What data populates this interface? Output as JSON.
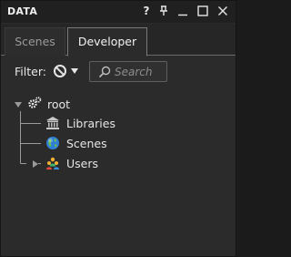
{
  "window": {
    "title": "DATA",
    "help_label": "?",
    "pin_label": "†",
    "minimize_label": "—",
    "maximize_label": "□",
    "close_label": "✕"
  },
  "tabs": [
    {
      "label": "Scenes",
      "active": false
    },
    {
      "label": "Developer",
      "active": true
    }
  ],
  "filter": {
    "label": "Filter:",
    "icon": "no-filter-icon",
    "search_placeholder": "Search",
    "search_value": ""
  },
  "tree": {
    "root": {
      "label": "root",
      "icon": "gears-icon",
      "expanded": true
    },
    "children": [
      {
        "label": "Libraries",
        "icon": "library-icon",
        "expandable": false
      },
      {
        "label": "Scenes",
        "icon": "globe-icon",
        "expandable": false
      },
      {
        "label": "Users",
        "icon": "users-icon",
        "expandable": true,
        "expanded": false
      }
    ]
  },
  "colors": {
    "background": "#2b2b2b",
    "titlebar": "#202020",
    "text": "#e6e6e6",
    "tree_line": "#9a9a9a"
  }
}
